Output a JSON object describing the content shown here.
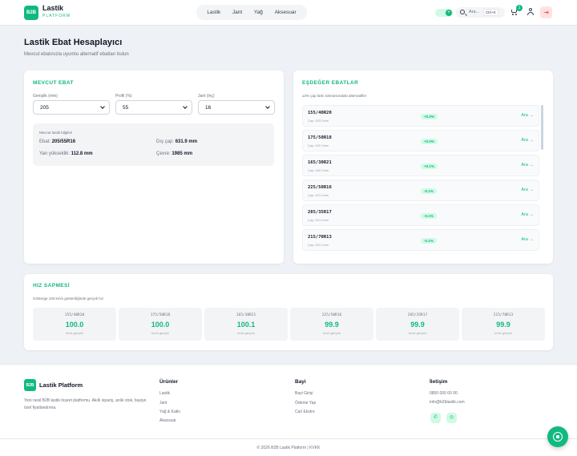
{
  "header": {
    "logo_text": "B2B",
    "brand": "Lastik",
    "brand_sub": "PLATFORM",
    "nav": [
      "Lastik",
      "Jant",
      "Yağ",
      "Aksesuar"
    ],
    "search_placeholder": "Ara...",
    "search_shortcut": "Ctrl+K",
    "cart_count": "1",
    "toggle_icon": "+",
    "logout_icon": "⇥"
  },
  "page": {
    "title": "Lastik Ebat Hesaplayıcı",
    "subtitle": "Mevcut ebatınızla uyumlu alternatif ebatları bulun"
  },
  "current": {
    "title": "MEVCUT EBAT",
    "fields": [
      {
        "label": "Genişlik (mm)",
        "value": "205"
      },
      {
        "label": "Profil (%)",
        "value": "55"
      },
      {
        "label": "Jant (inç)",
        "value": "16"
      }
    ],
    "info_title": "Mevcut lastik bilgileri",
    "info": {
      "ebat_label": "Ebat:",
      "ebat_value": "205/55R16",
      "dis_label": "Dış çap:",
      "dis_value": "631.9 mm",
      "yan_label": "Yan yükseklik:",
      "yan_value": "112.8 mm",
      "cevre_label": "Çevre:",
      "cevre_value": "1985 mm"
    }
  },
  "equivalents": {
    "title": "EŞDEĞER EBATLAR",
    "subtitle": "±3% çap farkı toleransındaki alternatifler",
    "link_label": "Ara →",
    "items": [
      {
        "size": "155/40R20",
        "dia": "Çap: 633.0mm",
        "diff": "+0.0%"
      },
      {
        "size": "175/50R18",
        "dia": "Çap: 632.3mm",
        "diff": "+0.0%"
      },
      {
        "size": "165/30R21",
        "dia": "Çap: 632.4mm",
        "diff": "+0.1%"
      },
      {
        "size": "225/50R16",
        "dia": "Çap: 631.4mm",
        "diff": "-0.1%"
      },
      {
        "size": "285/35R17",
        "dia": "Çap: 631.5mm",
        "diff": "-0.1%"
      },
      {
        "size": "215/70R13",
        "dia": "Çap: 631.2mm",
        "diff": "-0.1%"
      }
    ]
  },
  "speed": {
    "title": "HIZ SAPMESİ",
    "subtitle": "Gösterge 100 km/s gösterdiğinde gerçek hız",
    "unit": "km/s gerçek",
    "items": [
      {
        "size": "155/40R20",
        "value": "100.0"
      },
      {
        "size": "175/50R18",
        "value": "100.0"
      },
      {
        "size": "165/30R21",
        "value": "100.1"
      },
      {
        "size": "225/50R16",
        "value": "99.9"
      },
      {
        "size": "285/35R17",
        "value": "99.9"
      },
      {
        "size": "215/70R13",
        "value": "99.9"
      }
    ]
  },
  "footer": {
    "logo_text": "B2B",
    "brand": "Lastik Platform",
    "desc": "Yeni nesil B2B lastik ticaret platformu. Akıllı sipariş, anlık stok, bayiye özel fiyatlandırma.",
    "products_title": "Ürünler",
    "products": [
      "Lastik",
      "Jant",
      "Yağ & Katkı",
      "Aksesuar"
    ],
    "dealer_title": "Bayi",
    "dealer": [
      "Bayi Girişi",
      "Ödeme Yap",
      "Cari Ekstre"
    ],
    "contact_title": "İletişim",
    "phone": "0850 000 00 00",
    "email": "info@b2blastik.com",
    "copyright": "© 2026 B2B Lastik Platform  |  KVKK"
  },
  "colors": {
    "accent": "#10b981",
    "danger": "#ef4444"
  }
}
